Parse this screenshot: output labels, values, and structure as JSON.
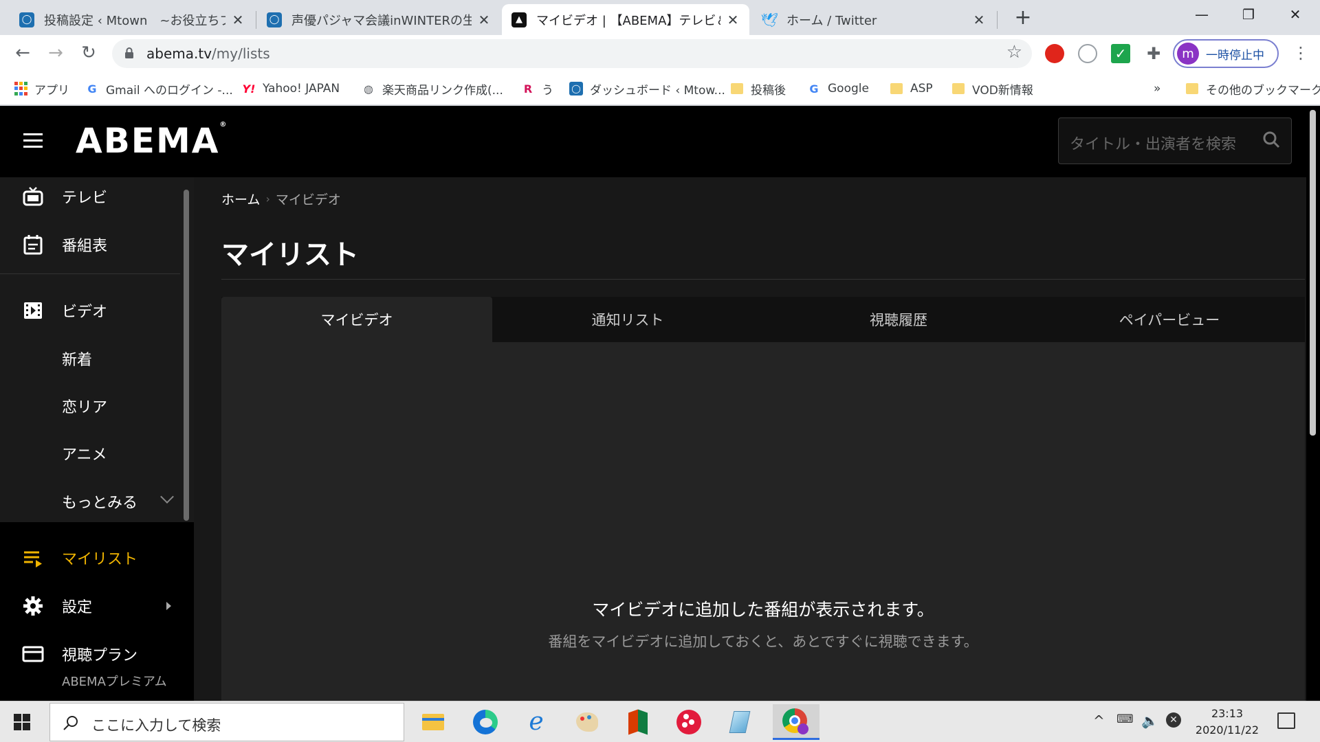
{
  "browser": {
    "tabs": [
      {
        "title": "投稿設定 ‹ Mtown　~お役立ちブロ",
        "active": false
      },
      {
        "title": "声優パジャマ会議inWINTERの生配",
        "active": false
      },
      {
        "title": "マイビデオ | 【ABEMA】テレビ＆ビデオ",
        "active": true
      },
      {
        "title": "ホーム / Twitter",
        "active": false
      }
    ],
    "new_tab_label": "+",
    "url_host": "abema.tv",
    "url_path": "/my/lists",
    "profile_initial": "m",
    "profile_label": "一時停止中",
    "bookmarks": [
      {
        "label": "アプリ"
      },
      {
        "label": "Gmail へのログイン -..."
      },
      {
        "label": "Yahoo! JAPAN"
      },
      {
        "label": "楽天商品リンク作成(..."
      },
      {
        "label": "う"
      },
      {
        "label": "ダッシュボード ‹ Mtow..."
      },
      {
        "label": "投稿後"
      },
      {
        "label": "Google"
      },
      {
        "label": "ASP"
      },
      {
        "label": "VOD新情報"
      },
      {
        "label": "その他のブックマーク"
      }
    ],
    "bookmarks_overflow": "»"
  },
  "abema": {
    "logo": "ABEMA",
    "search_placeholder": "タイトル・出演者を検索",
    "sidebar": {
      "items": [
        {
          "label": "テレビ",
          "icon": "tv-icon"
        },
        {
          "label": "番組表",
          "icon": "calendar-icon"
        },
        {
          "label": "ビデオ",
          "icon": "film-icon"
        },
        {
          "label": "新着"
        },
        {
          "label": "恋リア"
        },
        {
          "label": "アニメ"
        },
        {
          "label": "もっとみる"
        },
        {
          "label": "マイリスト",
          "icon": "mylist-icon"
        },
        {
          "label": "設定",
          "icon": "gear-icon"
        },
        {
          "label": "視聴プラン",
          "icon": "card-icon"
        }
      ],
      "plan_sub": "ABEMAプレミアム"
    },
    "breadcrumb": {
      "home": "ホーム",
      "separator": "›",
      "current": "マイビデオ"
    },
    "page_title": "マイリスト",
    "tabs": [
      "マイビデオ",
      "通知リスト",
      "視聴履歴",
      "ペイパービュー"
    ],
    "empty": {
      "title": "マイビデオに追加した番組が表示されます。",
      "subtitle": "番組をマイビデオに追加しておくと、あとですぐに視聴できます。"
    },
    "accent_color": "#f0b400"
  },
  "taskbar": {
    "search_placeholder": "ここに入力して検索",
    "time": "23:13",
    "date": "2020/11/22"
  }
}
